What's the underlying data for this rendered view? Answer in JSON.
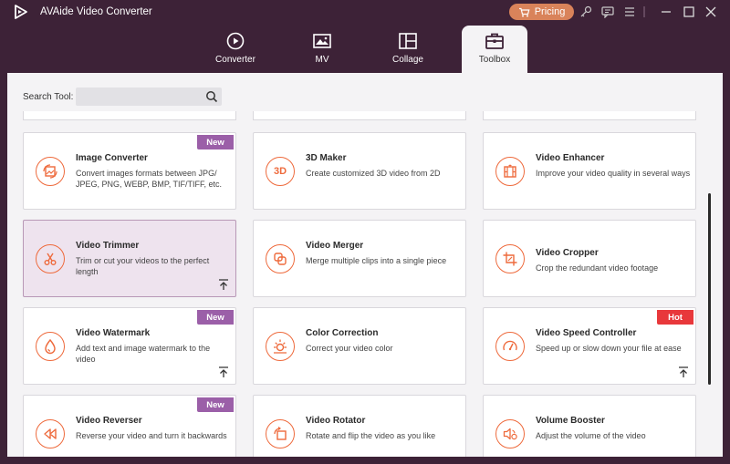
{
  "app": {
    "title": "AVAide Video Converter",
    "pricing_label": "Pricing"
  },
  "colors": {
    "accent": "#ee6a3c",
    "new_badge": "#9b5fa8",
    "hot_badge": "#e8383b",
    "titlebar": "#3d2237"
  },
  "tabs": [
    {
      "label": "Converter",
      "icon": "converter-icon"
    },
    {
      "label": "MV",
      "icon": "mv-icon"
    },
    {
      "label": "Collage",
      "icon": "collage-icon"
    },
    {
      "label": "Toolbox",
      "icon": "toolbox-icon",
      "active": true
    }
  ],
  "search": {
    "label": "Search Tool:",
    "value": "",
    "placeholder": ""
  },
  "tools": [
    {
      "title": "Image Converter",
      "desc": "Convert images formats between JPG/ JPEG, PNG, WEBP, BMP, TIF/TIFF, etc.",
      "badge": "New",
      "icon": "image-converter-icon"
    },
    {
      "title": "3D Maker",
      "desc": "Create customized 3D video from 2D",
      "icon": "3d-icon"
    },
    {
      "title": "Video Enhancer",
      "desc": "Improve your video quality in several ways",
      "icon": "enhancer-icon"
    },
    {
      "title": "Video Trimmer",
      "desc": "Trim or cut your videos to the perfect length",
      "icon": "scissors-icon",
      "pinned": true,
      "selected": true
    },
    {
      "title": "Video Merger",
      "desc": "Merge multiple clips into a single piece",
      "icon": "merge-icon"
    },
    {
      "title": "Video Cropper",
      "desc": "Crop the redundant video footage",
      "icon": "crop-icon"
    },
    {
      "title": "Video Watermark",
      "desc": "Add text and image watermark to the video",
      "badge": "New",
      "icon": "watermark-icon",
      "pinned": true
    },
    {
      "title": "Color Correction",
      "desc": "Correct your video color",
      "icon": "sun-icon"
    },
    {
      "title": "Video Speed Controller",
      "desc": "Speed up or slow down your file at ease",
      "badge": "Hot",
      "icon": "speedometer-icon",
      "pinned": true
    },
    {
      "title": "Video Reverser",
      "desc": "Reverse your video and turn it backwards",
      "badge": "New",
      "icon": "rewind-icon"
    },
    {
      "title": "Video Rotator",
      "desc": "Rotate and flip the video as you like",
      "icon": "rotate-icon"
    },
    {
      "title": "Volume Booster",
      "desc": "Adjust the volume of the video",
      "icon": "volume-icon"
    }
  ]
}
